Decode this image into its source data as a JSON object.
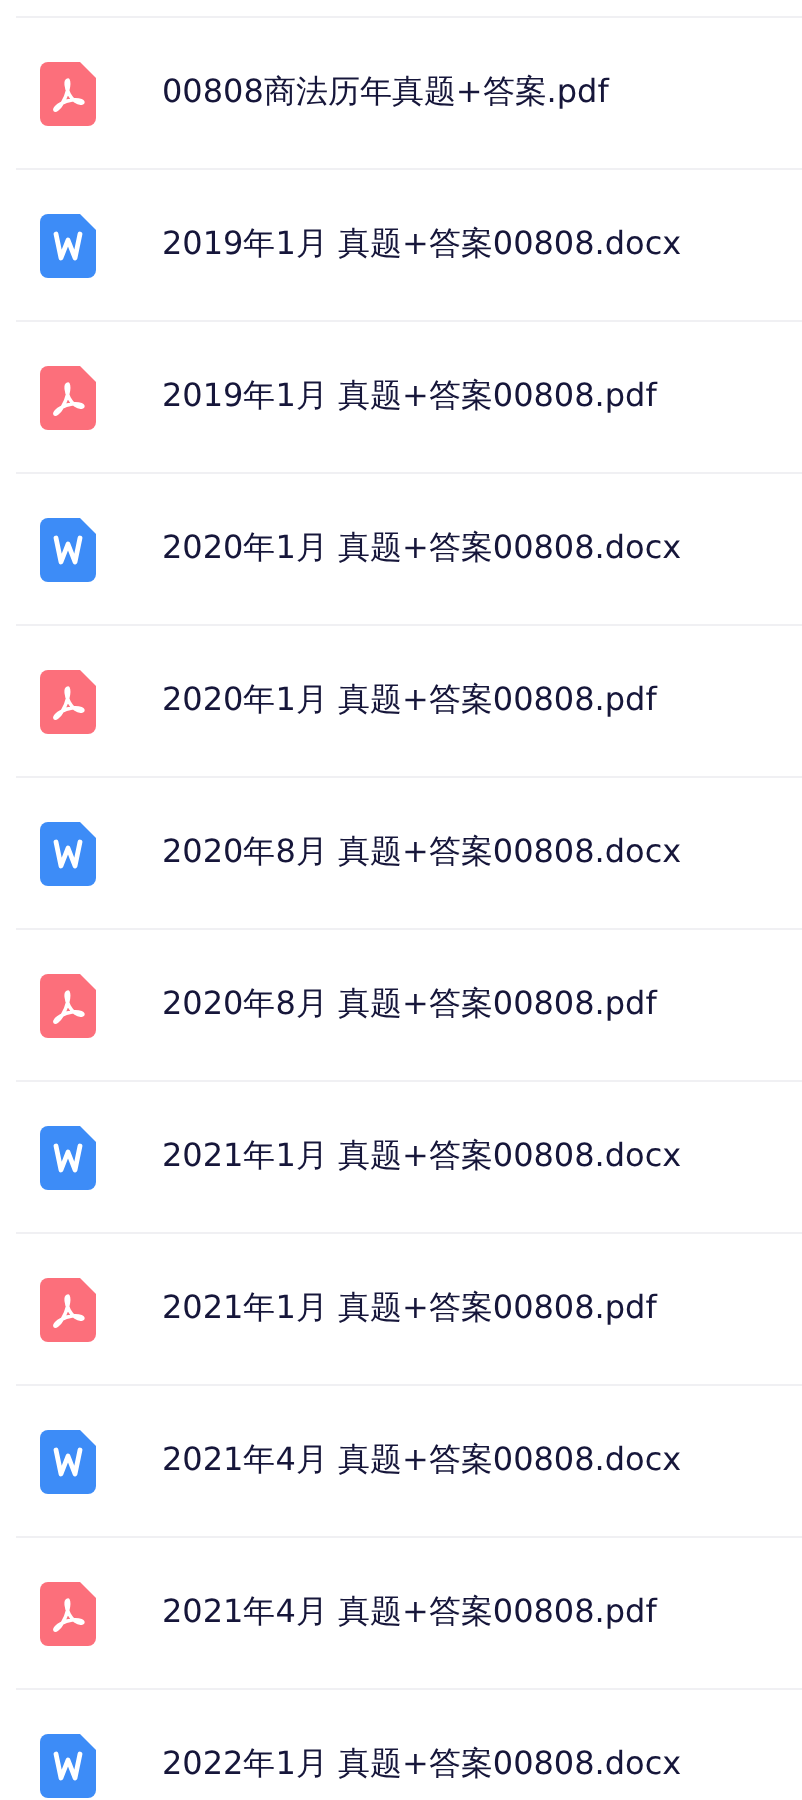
{
  "files": [
    {
      "kind": "pdf",
      "name": "00808商法历年真题+答案.pdf"
    },
    {
      "kind": "word",
      "name": "2019年1月 真题+答案00808.docx"
    },
    {
      "kind": "pdf",
      "name": "2019年1月 真题+答案00808.pdf"
    },
    {
      "kind": "word",
      "name": "2020年1月 真题+答案00808.docx"
    },
    {
      "kind": "pdf",
      "name": "2020年1月 真题+答案00808.pdf"
    },
    {
      "kind": "word",
      "name": "2020年8月 真题+答案00808.docx"
    },
    {
      "kind": "pdf",
      "name": "2020年8月 真题+答案00808.pdf"
    },
    {
      "kind": "word",
      "name": "2021年1月 真题+答案00808.docx"
    },
    {
      "kind": "pdf",
      "name": "2021年1月 真题+答案00808.pdf"
    },
    {
      "kind": "word",
      "name": "2021年4月 真题+答案00808.docx"
    },
    {
      "kind": "pdf",
      "name": "2021年4月 真题+答案00808.pdf"
    },
    {
      "kind": "word",
      "name": "2022年1月 真题+答案00808.docx"
    }
  ]
}
